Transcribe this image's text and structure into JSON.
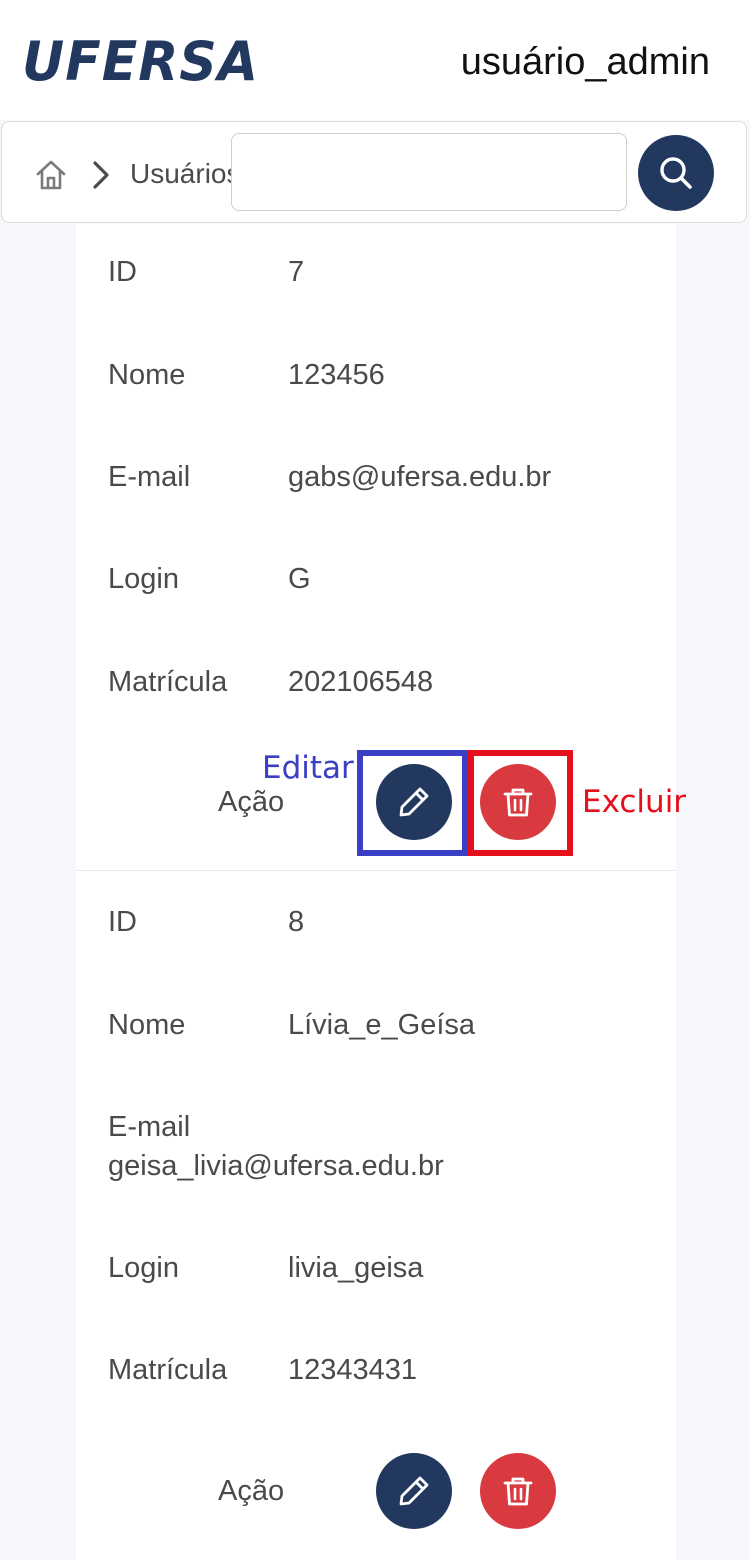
{
  "header": {
    "logo_text": "UFERSA",
    "username": "usuário_admin"
  },
  "toolbar": {
    "breadcrumb": "Usuários",
    "search_value": "",
    "search_placeholder": ""
  },
  "records": [
    {
      "id_label": "ID",
      "id": "7",
      "name_label": "Nome",
      "name": "123456",
      "email_label": "E-mail",
      "email": "gabs@ufersa.edu.br",
      "login_label": "Login",
      "login": "G",
      "matricula_label": "Matrícula",
      "matricula": "202106548",
      "action_label": "Ação"
    },
    {
      "id_label": "ID",
      "id": "8",
      "name_label": "Nome",
      "name": "Lívia_e_Geísa",
      "email_label": "E-mail",
      "email": "geisa_livia@ufersa.edu.br",
      "login_label": "Login",
      "login": "livia_geisa",
      "matricula_label": "Matrícula",
      "matricula": "12343431",
      "action_label": "Ação"
    }
  ],
  "annotations": {
    "edit": "Editar",
    "delete": "Excluir"
  },
  "colors": {
    "primary": "#22385f",
    "danger": "#d93a3f",
    "annotation_edit": "#3a3fc4",
    "annotation_delete": "#e5101c"
  },
  "icons": {
    "home": "home-icon",
    "breadcrumb_separator": "chevron-right-icon",
    "search": "search-icon",
    "edit": "pencil-icon",
    "delete": "trash-icon"
  }
}
